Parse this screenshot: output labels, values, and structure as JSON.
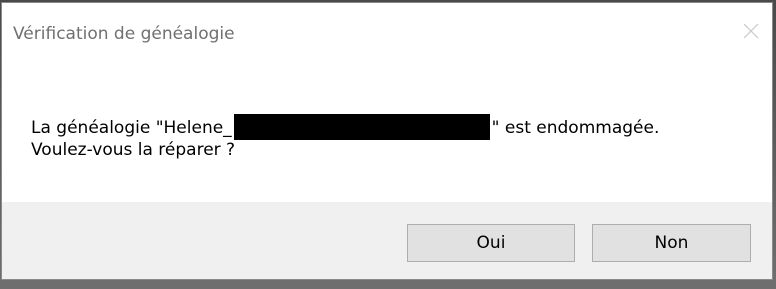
{
  "dialog": {
    "title": "Vérification de généalogie",
    "close_icon": "close-icon",
    "message": {
      "prefix": "La généalogie \"Helene_",
      "redacted": "",
      "suffix": "\" est endommagée.",
      "line2": "Voulez-vous la réparer ?"
    },
    "buttons": {
      "yes_label": "Oui",
      "no_label": "Non"
    }
  },
  "colors": {
    "title_text": "#707070",
    "footer_bg": "#f0f0f0",
    "button_bg": "#e1e1e1",
    "button_border": "#adadad",
    "redaction": "#000000"
  }
}
